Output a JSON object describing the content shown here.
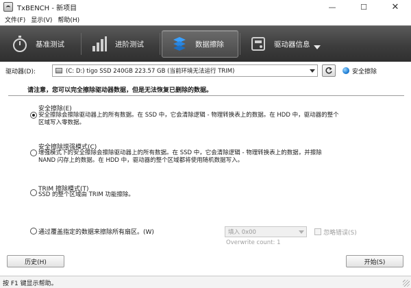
{
  "window": {
    "title": "TxBENCH - 新项目",
    "minimize": "—",
    "maximize": "☐",
    "close": "✕"
  },
  "menu": [
    "文件(F)",
    "显示(V)",
    "帮助(H)"
  ],
  "tabs": [
    {
      "label": "基准测试",
      "icon": "stopwatch-icon"
    },
    {
      "label": "进阶测试",
      "icon": "bar-chart-icon"
    },
    {
      "label": "数据擦除",
      "icon": "erase-layers-icon",
      "active": true
    },
    {
      "label": "驱动器信息",
      "icon": "drive-info-icon"
    }
  ],
  "drive": {
    "label": "驱动器(D):",
    "selected": "(C: D:) tigo SSD 240GB  223.57 GB (当前环境无法运行 TRIM)",
    "status": "安全擦除"
  },
  "warning": "请注意，您可以完全擦除驱动器数据，但是无法恢复已删除的数据。",
  "options": [
    {
      "title": "安全擦除(E)",
      "desc": [
        "安全擦除会擦除驱动器上的所有数据。在 SSD 中，它会清除逻辑 - 物理转换表上的数据。在 HDD 中，驱动器的整个",
        "区域写入零数据。"
      ],
      "checked": true
    },
    {
      "title": "安全擦除增强模式(C)",
      "desc": [
        "增强模式下的安全擦除会擦除驱动器上的所有数据。在 SSD 中，它会清除逻辑 - 物理转换表上的数据，并擦除",
        "NAND 闪存上的数据。在 HDD 中，驱动器的整个区域都将使用随机数据写入。"
      ],
      "checked": false
    },
    {
      "title": "TRIM 擦除模式(T)",
      "desc": [
        "SSD 的整个区域由 TRIM 功能擦除。"
      ],
      "checked": false
    },
    {
      "title": "通过覆盖指定的数据来擦除所有扇区。(W)",
      "desc": [],
      "checked": false
    }
  ],
  "overwrite": {
    "fill_value": "填入 0x00",
    "count_label": "Overwrite count: 1",
    "ignore_errors": "忽略错误(S)"
  },
  "buttons": {
    "history": "历史(H)",
    "start": "开始(S)"
  },
  "statusbar": "按 F1 键显示帮助。",
  "colors": {
    "toolbar": "#3d3d3d",
    "status_dot": "#1f7fd6"
  }
}
